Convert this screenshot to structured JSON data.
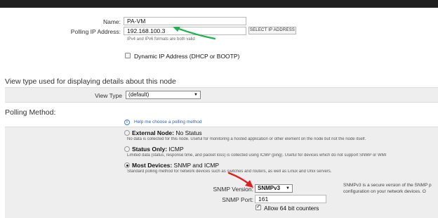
{
  "form": {
    "name_label": "Name:",
    "name_value": "PA-VM",
    "ip_label": "Polling IP Address:",
    "ip_value": "192.168.100.3",
    "select_ip_button": "SELECT IP ADDRESS",
    "ip_hint": "IPv4 and IPv6 formats are both valid",
    "dynamic_ip_label": "Dynamic IP Address (DHCP or BOOTP)",
    "dynamic_ip_checked": false
  },
  "view_section": {
    "title": "View type used for displaying details about this node",
    "label": "View Type",
    "selected": "(default)"
  },
  "polling": {
    "title": "Polling Method:",
    "help_link": "Help me choose a polling method",
    "options": [
      {
        "title_bold": "External Node:",
        "title_rest": " No Status",
        "desc": "No data is collected for this node. Useful for monitoring a hosted application or other element on the node but not the node itself.",
        "selected": false
      },
      {
        "title_bold": "Status Only:",
        "title_rest": " ICMP",
        "desc": "Limited data (status, response time, and packet loss) is collected using ICMP (ping). Useful for devices which do not support SNMP or WMI",
        "selected": false
      },
      {
        "title_bold": "Most Devices:",
        "title_rest": " SNMP and ICMP",
        "desc": "Standard polling method for network devices such as switches and routers, as well as Linux and Unix servers.",
        "selected": true
      }
    ],
    "snmp_version_label": "SNMP Version:",
    "snmp_version_value": "SNMPv3",
    "snmp_port_label": "SNMP Port:",
    "snmp_port_value": "161",
    "allow64_label": "Allow 64 bit counters",
    "allow64_checked": true,
    "snmpv3_note_line1": "SNMPv3 is a secure version of the SNMP p",
    "snmpv3_note_line2": "configuration on your network devices. O"
  },
  "annotations": {
    "green_arrow_color": "#22b14c",
    "red_arrow_color": "#e02020"
  }
}
